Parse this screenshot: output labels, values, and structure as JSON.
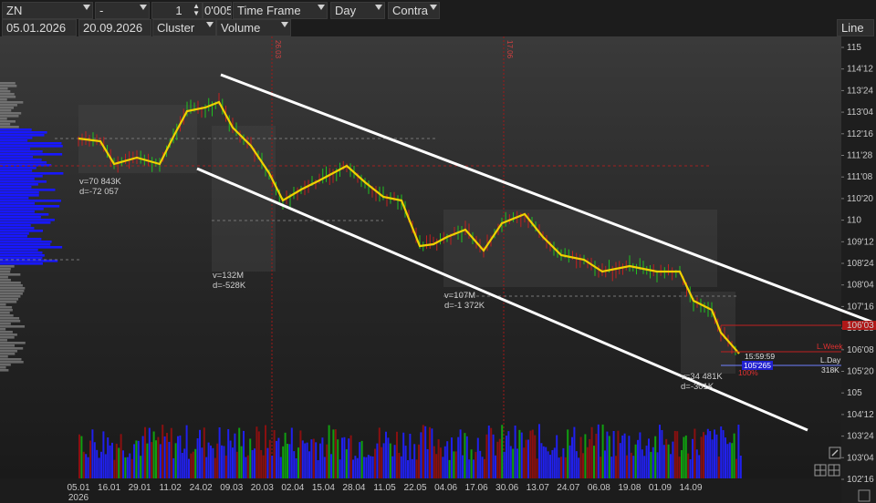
{
  "toolbar": {
    "symbol": "ZN",
    "period_mode": "-",
    "period_count": "1",
    "tick_size": "0'005",
    "timeframe_label": "Time Frame",
    "interval": "Day",
    "style_mode": "Contra",
    "date_from": "05.01.2026",
    "date_to": "20.09.2026",
    "chart_type": "Cluster",
    "cluster_metric": "Volume",
    "line_button": "Line"
  },
  "price_axis": [
    "115",
    "114'12",
    "113'24",
    "113'04",
    "112'16",
    "111'28",
    "111'08",
    "110'20",
    "110",
    "109'12",
    "108'24",
    "108'04",
    "107'16",
    "106'28",
    "106'08",
    "105'20",
    "105",
    "104'12",
    "103'24",
    "103'04",
    "102'16"
  ],
  "date_axis": [
    {
      "label": "05.01",
      "sub": "2026"
    },
    {
      "label": "16.01"
    },
    {
      "label": "29.01"
    },
    {
      "label": "11.02"
    },
    {
      "label": "24.02"
    },
    {
      "label": "09.03"
    },
    {
      "label": "20.03"
    },
    {
      "label": "02.04"
    },
    {
      "label": "15.04"
    },
    {
      "label": "28.04"
    },
    {
      "label": "11.05"
    },
    {
      "label": "22.05"
    },
    {
      "label": "04.06"
    },
    {
      "label": "17.06"
    },
    {
      "label": "30.06"
    },
    {
      "label": "13.07"
    },
    {
      "label": "24.07"
    },
    {
      "label": "06.08"
    },
    {
      "label": "19.08"
    },
    {
      "label": "01.09"
    },
    {
      "label": "14.09"
    }
  ],
  "profiles": [
    {
      "v": "v=70 843K",
      "d": "d=-72 057"
    },
    {
      "v": "v=132M",
      "d": "d=-528K"
    },
    {
      "v": "v=107M",
      "d": "d=-1 372K"
    },
    {
      "v": "v=34 481K",
      "d": "d=-301K"
    }
  ],
  "markers": {
    "vline1": "26.03",
    "vline2": "17.06",
    "time": "15:59:59",
    "current_price": "105'265",
    "week_label": "L.Week",
    "day_label": "L.Day",
    "day_value": "318K",
    "percent": "100%",
    "week_price_tag": "106'03"
  },
  "colors": {
    "background": "#1c1c1c",
    "volume_profile": "#1a1aff",
    "channel": "#ffffff",
    "price_line": "#f0d000"
  }
}
